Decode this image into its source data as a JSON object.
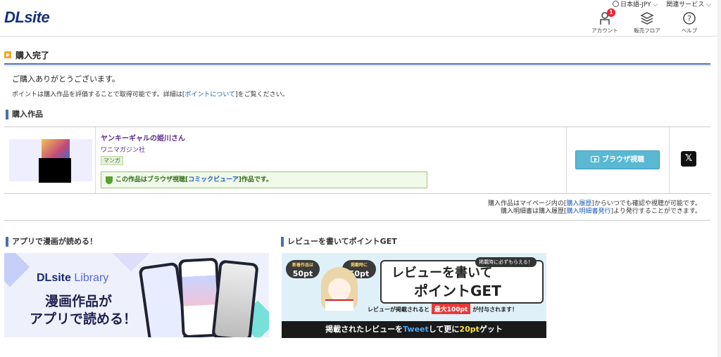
{
  "header": {
    "logo": "DLsite",
    "language": "日本語-JPY",
    "related_services": "関連サービス",
    "icons": [
      {
        "label": "アカウント",
        "badge": "1"
      },
      {
        "label": "販売フロア"
      },
      {
        "label": "ヘルプ"
      }
    ]
  },
  "page": {
    "title": "購入完了",
    "thanks": "ご購入ありがとうございます。",
    "points_prefix": "ポイントは購入作品を評価することで取得可能です。詳細は[",
    "points_link": "ポイントについて",
    "points_suffix": "]をご覧ください。"
  },
  "purchased": {
    "heading": "購入作品",
    "item": {
      "title": "ヤンキーギャルの姫川さん",
      "maker": "ワニマガジン社",
      "tag": "マンガ",
      "notice_prefix": "この作品はブラウザ視聴[",
      "notice_link": "コミックビューア",
      "notice_suffix": "]作品です。",
      "browser_button": "ブラウザ視聴",
      "share_icon": "x-icon",
      "share_glyph": "𝕏"
    },
    "history_line1_prefix": "購入作品はマイページ内の[",
    "history_line1_link": "購入履歴",
    "history_line1_suffix": "]からいつでも確認や視聴が可能です。",
    "history_line2_prefix": "購入明細書は購入履歴[",
    "history_line2_link": "購入明細書発行",
    "history_line2_suffix": "]より発行することができます。"
  },
  "app_banner": {
    "heading": "アプリで漫画が読める！",
    "logo_brand": "DLsite",
    "logo_product": "Library",
    "line1": "漫画作品が",
    "line2": "アプリで読める！"
  },
  "review_banner": {
    "heading": "レビューを書いてポイントGET",
    "pill1_small": "新着作品は",
    "pill1": "50pt",
    "pill2_small": "掲載時に",
    "pill2": "50pt",
    "title1": "レビューを書いて",
    "title2": "ポイントGET",
    "sub": "掲載時に必ずもらえる！",
    "desc_prefix": "レビューが掲載されると",
    "desc_highlight": "最大100pt",
    "desc_suffix": "が付与されます！",
    "bottom_prefix": "掲載されたレビューを",
    "bottom_tweet": "Tweet",
    "bottom_mid": "して更に",
    "bottom_points": "20pt",
    "bottom_suffix": "ゲット"
  },
  "colors": {
    "brand": "#13317e",
    "accent_blue": "#4a6fb6",
    "button": "#5ab8d3",
    "badge": "#ee2233",
    "link": "#1a5db8"
  }
}
